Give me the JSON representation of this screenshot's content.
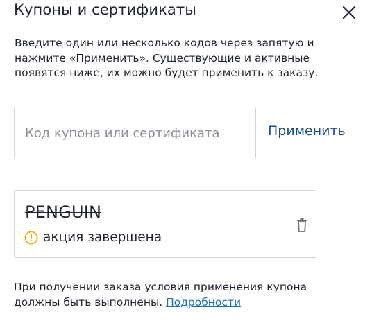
{
  "modal": {
    "title": "Купоны и сертификаты",
    "close_icon": "close-icon"
  },
  "intro": {
    "line1": "Введите один или несколько кодов через запятую и",
    "line2": "нажмите «Применить». Существующие и активные",
    "line3": "появятся ниже, их можно будет применить к заказу."
  },
  "coupon_form": {
    "input_value": "",
    "input_placeholder": "Код купона или сертификата",
    "apply_label": "Применить"
  },
  "applied_coupon": {
    "code": "PENGUIN",
    "status_icon": "warning-icon",
    "status_text": "акция завершена",
    "status_color": "#e5b100",
    "delete_icon": "trash-icon"
  },
  "footer": {
    "note_line1": "При получении заказа условия применения купона",
    "note_line2": "должны быть выполнены.",
    "details_link": "Подробности"
  },
  "colors": {
    "text": "#1f2530",
    "accent": "#1a4d8f",
    "link": "#1a6fb5",
    "border": "#d2d6dc"
  }
}
